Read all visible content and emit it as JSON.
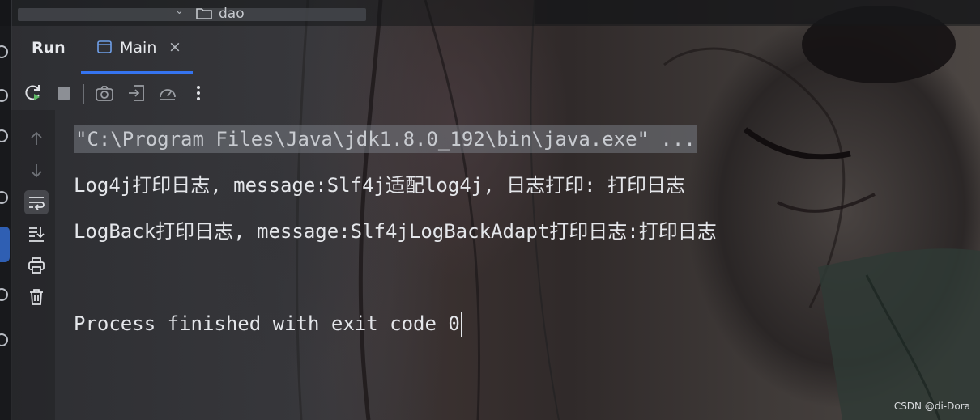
{
  "breadcrumb": {
    "folder_name": "dao"
  },
  "run_panel": {
    "run_label": "Run",
    "tab": {
      "label": "Main",
      "close_glyph": "×",
      "icon": "console-window-icon"
    }
  },
  "toolbar": {
    "icons": [
      "rerun-icon",
      "stop-icon",
      "camera-icon",
      "import-dump-icon",
      "profiler-icon",
      "more-options-icon"
    ]
  },
  "gutter": {
    "icons": [
      "arrow-up-icon",
      "arrow-down-icon",
      "soft-wrap-icon",
      "scroll-to-end-icon",
      "print-icon",
      "trash-icon"
    ],
    "active": "soft-wrap-icon"
  },
  "console": {
    "command": "\"C:\\Program Files\\Java\\jdk1.8.0_192\\bin\\java.exe\" ...",
    "output_line_1": "Log4j打印日志, message:Slf4j适配log4j, 日志打印: 打印日志",
    "output_line_2": "LogBack打印日志, message:Slf4jLogBackAdapt打印日志:打印日志",
    "exit_message": "Process finished with exit code 0"
  },
  "watermark": "CSDN @di-Dora",
  "colors": {
    "accent": "#3574f0",
    "rerun_green": "#5fb865",
    "text": "#e4e6ea"
  }
}
